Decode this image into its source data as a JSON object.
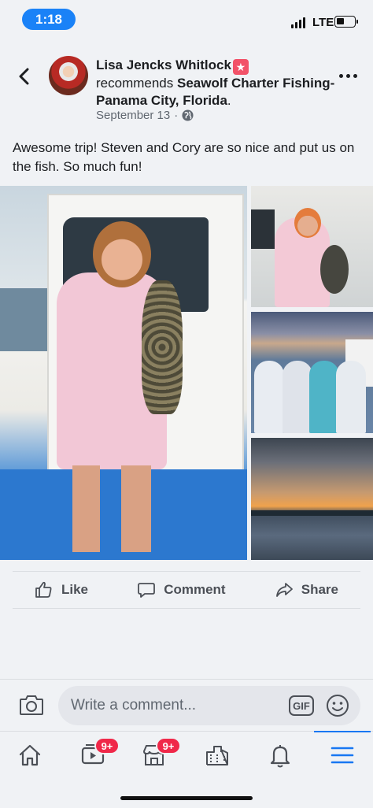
{
  "status_bar": {
    "time": "1:18",
    "network": "LTE",
    "battery_level": 0.45
  },
  "post": {
    "author": "Lisa Jencks Whitlock",
    "recommends_text": "recommends",
    "page_name": "Seawolf Charter Fishing- Panama City, Florida",
    "date": "September 13",
    "separator": "·",
    "body": "Awesome trip! Steven and Cory are so nice and put us on the fish. So much fun!",
    "photo_count": 4
  },
  "actions": {
    "like": "Like",
    "comment": "Comment",
    "share": "Share"
  },
  "comment_bar": {
    "placeholder": "Write a comment...",
    "gif_label": "GIF"
  },
  "bottom_nav": {
    "items": [
      {
        "name": "home",
        "badge": ""
      },
      {
        "name": "watch",
        "badge": "9+"
      },
      {
        "name": "marketplace",
        "badge": "9+"
      },
      {
        "name": "pages",
        "badge": ""
      },
      {
        "name": "notifications",
        "badge": ""
      },
      {
        "name": "menu",
        "badge": "",
        "active": true
      }
    ]
  },
  "colors": {
    "accent": "#1877f2",
    "time_pill": "#1a82f7",
    "badge": "#f02849",
    "star": "#f25268"
  }
}
